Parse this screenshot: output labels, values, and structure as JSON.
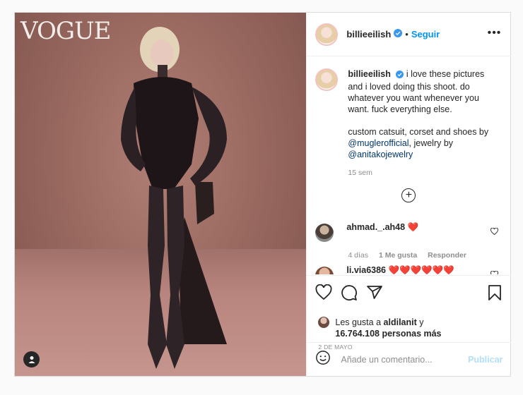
{
  "photo": {
    "logo_text": "VOGUE",
    "tag_icon": "user-tag-icon"
  },
  "header": {
    "username": "billieeilish",
    "separator": "•",
    "follow_label": "Seguir",
    "more_icon": "more-options-icon",
    "more_label": "•••"
  },
  "caption": {
    "username": "billieeilish",
    "text_1": "i love these pictures and i loved doing this shoot. do whatever you want whenever you want. fuck everything else.",
    "text_2": "custom catsuit, corset and shoes by",
    "mention_1": "@muglerofficial",
    "text_3": ", jewelry by",
    "mention_2": "@anitakojewelry",
    "time": "15 sem"
  },
  "load_more_label": "+",
  "comments": [
    {
      "username": "ahmad._.ah48",
      "text": "❤️",
      "time": "4 días",
      "likes": "1 Me gusta",
      "reply": "Responder"
    },
    {
      "username": "li.via6386",
      "text": "❤️❤️❤️❤️❤️❤️"
    }
  ],
  "likes": {
    "prefix": "Les gusta a",
    "user": "aldilanit",
    "connector": "y",
    "others": "16.764.108 personas más"
  },
  "date": "2 DE MAYO",
  "composer": {
    "placeholder": "Añade un comentario...",
    "publish_label": "Publicar"
  },
  "colors": {
    "accent": "#0095f6",
    "publish_disabled": "#b2dffc",
    "heart": "#ed1c24",
    "muted": "#8e8e8e"
  }
}
